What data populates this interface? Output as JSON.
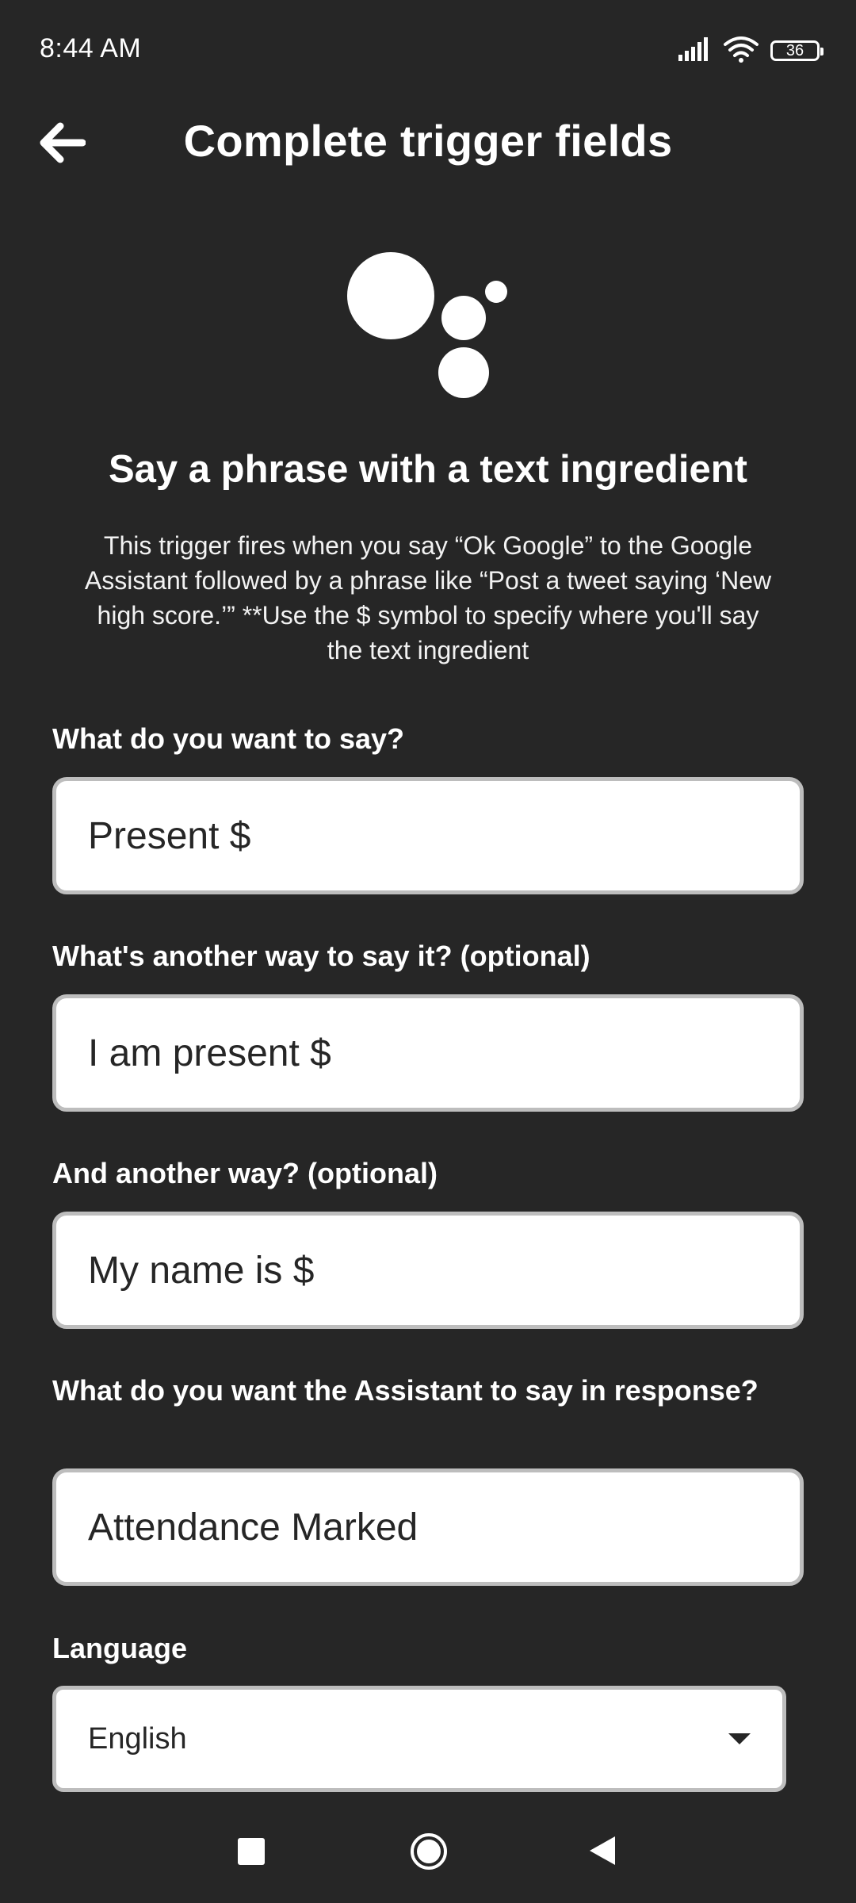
{
  "status_bar": {
    "time": "8:44 AM",
    "battery": "36",
    "icons": [
      "signal-icon",
      "wifi-icon",
      "battery-icon"
    ]
  },
  "header": {
    "title": "Complete trigger fields",
    "back_icon": "arrow-left-icon"
  },
  "service": {
    "logo": "google-assistant-logo",
    "heading": "Say a phrase with a text ingredient",
    "description": "This trigger fires when you say “Ok Google” to the Google Assistant followed by a phrase like “Post a tweet saying ‘New high score.’” **Use the $ symbol to specify where you'll say the text ingredient"
  },
  "fields": {
    "phrase": {
      "label": "What do you want to say?",
      "value": "Present $"
    },
    "phrase2": {
      "label": "What's another way to say it? (optional)",
      "value": "I am present $"
    },
    "phrase3": {
      "label": "And another way? (optional)",
      "value": "My name is $"
    },
    "response": {
      "label": "What do you want the Assistant to say in response?",
      "value": "Attendance Marked"
    },
    "language": {
      "label": "Language",
      "value": "English",
      "icon": "caret-down-icon"
    }
  },
  "nav_bar": {
    "icons": [
      "recents-square-icon",
      "home-circle-icon",
      "back-triangle-icon"
    ]
  },
  "colors": {
    "background": "#262626",
    "text": "#ffffff",
    "input_bg": "#ffffff",
    "input_border": "#bdbdbd",
    "input_text": "#262626"
  }
}
